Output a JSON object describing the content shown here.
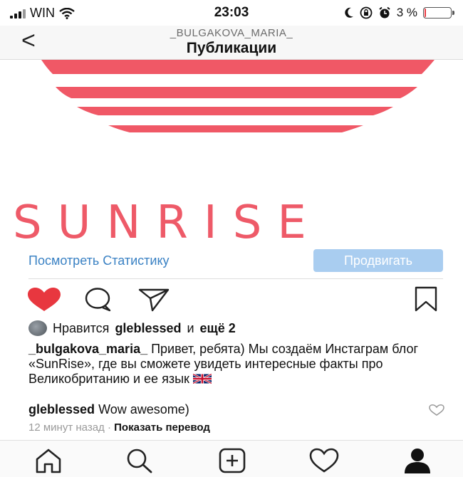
{
  "status_bar": {
    "carrier": "WIN",
    "time": "23:03",
    "battery_text": "3 %",
    "battery_level": 0.03
  },
  "nav": {
    "back_label": "<",
    "username": "_BULGAKOVA_MARIA_",
    "title": "Публикации"
  },
  "post": {
    "image_text": "SUNRISE",
    "image_color": "#ee5a68",
    "stats_link": "Посмотреть Статистику",
    "promote_button": "Продвигать"
  },
  "likes": {
    "prefix": "Нравится",
    "user": "gleblessed",
    "connector": "и",
    "others": "ещё 2"
  },
  "caption": {
    "author": "_bulgakova_maria_",
    "text": "Привет, ребята) Мы создаём Инстаграм блог «SunRise», где вы сможете увидеть интересные факты про Великобританию и ее язык"
  },
  "comment": {
    "author": "gleblessed",
    "text": "Wow awesome)"
  },
  "meta": {
    "time_ago": "12 минут назад",
    "separator": "·",
    "translate": "Показать перевод"
  },
  "colors": {
    "like_active": "#e8373f",
    "link": "#3b82c4",
    "promote_bg": "#a9cdf0"
  }
}
